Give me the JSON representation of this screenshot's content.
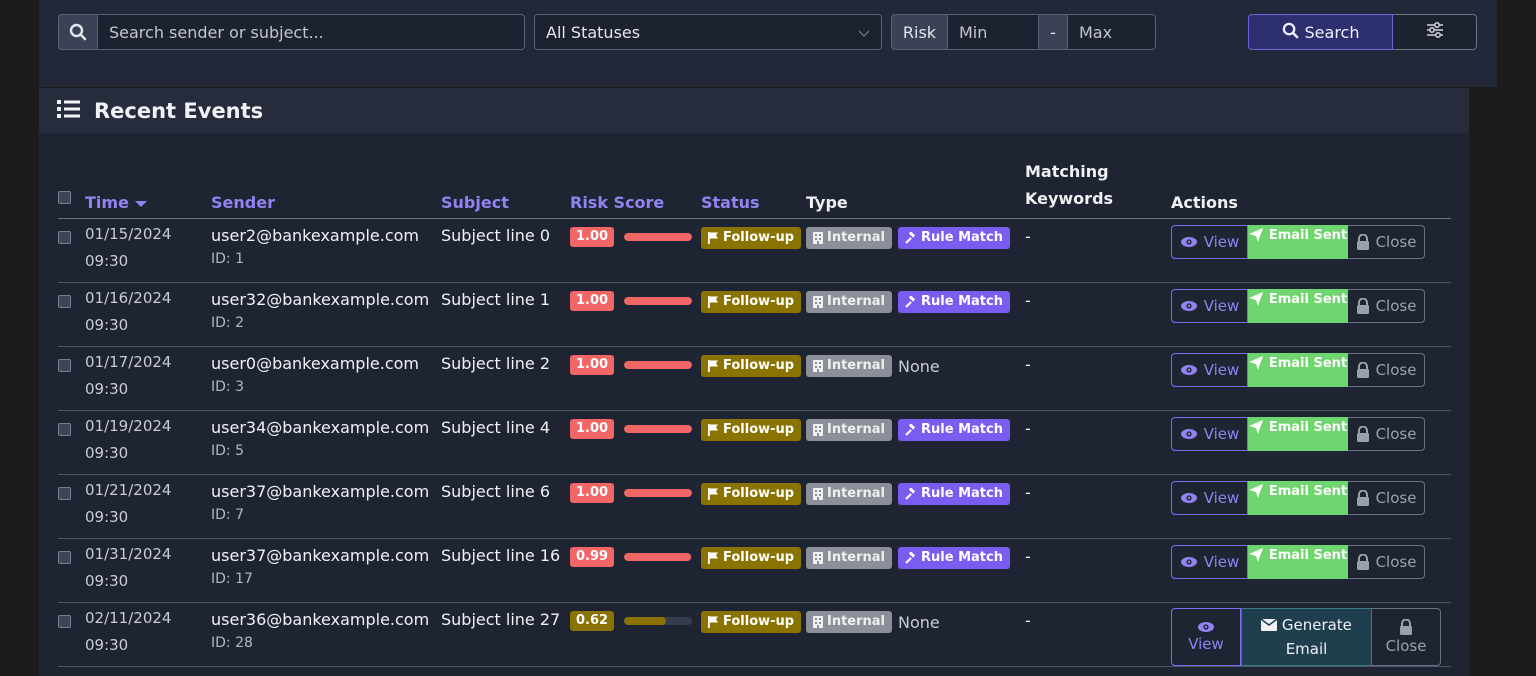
{
  "filters": {
    "search_placeholder": "Search sender or subject...",
    "status_value": "All Statuses",
    "risk_label": "Risk",
    "risk_min_placeholder": "Min",
    "risk_dash": "-",
    "risk_max_placeholder": "Max",
    "search_button": "Search"
  },
  "events": {
    "title": "Recent Events",
    "columns": {
      "time": "Time",
      "sender": "Sender",
      "subject": "Subject",
      "risk": "Risk Score",
      "status": "Status",
      "type": "Type",
      "keywords_line1": "Matching",
      "keywords_line2": "Keywords",
      "actions": "Actions"
    },
    "rows": [
      {
        "date": "01/15/2024",
        "time": "09:30",
        "sender": "user2@bankexample.com",
        "id": "ID: 1",
        "subject": "Subject line 0",
        "risk": "1.00",
        "risk_level": 1.0,
        "status": "Follow-up",
        "type": "Internal",
        "rule": "Rule Match",
        "keywords": "-",
        "view": "View",
        "email": "Email Sent",
        "close": "Close"
      },
      {
        "date": "01/16/2024",
        "time": "09:30",
        "sender": "user32@bankexample.com",
        "id": "ID: 2",
        "subject": "Subject line 1",
        "risk": "1.00",
        "risk_level": 1.0,
        "status": "Follow-up",
        "type": "Internal",
        "rule": "Rule Match",
        "keywords": "-",
        "view": "View",
        "email": "Email Sent",
        "close": "Close"
      },
      {
        "date": "01/17/2024",
        "time": "09:30",
        "sender": "user0@bankexample.com",
        "id": "ID: 3",
        "subject": "Subject line 2",
        "risk": "1.00",
        "risk_level": 1.0,
        "status": "Follow-up",
        "type": "Internal",
        "rule": "None",
        "keywords": "-",
        "view": "View",
        "email": "Email Sent",
        "close": "Close"
      },
      {
        "date": "01/19/2024",
        "time": "09:30",
        "sender": "user34@bankexample.com",
        "id": "ID: 5",
        "subject": "Subject line 4",
        "risk": "1.00",
        "risk_level": 1.0,
        "status": "Follow-up",
        "type": "Internal",
        "rule": "Rule Match",
        "keywords": "-",
        "view": "View",
        "email": "Email Sent",
        "close": "Close"
      },
      {
        "date": "01/21/2024",
        "time": "09:30",
        "sender": "user37@bankexample.com",
        "id": "ID: 7",
        "subject": "Subject line 6",
        "risk": "1.00",
        "risk_level": 1.0,
        "status": "Follow-up",
        "type": "Internal",
        "rule": "Rule Match",
        "keywords": "-",
        "view": "View",
        "email": "Email Sent",
        "close": "Close"
      },
      {
        "date": "01/31/2024",
        "time": "09:30",
        "sender": "user37@bankexample.com",
        "id": "ID: 17",
        "subject": "Subject line 16",
        "risk": "0.99",
        "risk_level": 0.99,
        "status": "Follow-up",
        "type": "Internal",
        "rule": "Rule Match",
        "keywords": "-",
        "view": "View",
        "email": "Email Sent",
        "close": "Close"
      },
      {
        "date": "02/11/2024",
        "time": "09:30",
        "sender": "user36@bankexample.com",
        "id": "ID: 28",
        "subject": "Subject line 27",
        "risk": "0.62",
        "risk_level": 0.62,
        "status": "Follow-up",
        "type": "Internal",
        "rule": "None",
        "keywords": "-",
        "view": "View",
        "email_line1": "Generate",
        "email_line2": "Email",
        "close": "Close"
      }
    ]
  },
  "colors": {
    "accent": "#8f84f0",
    "risk_high": "#f26666",
    "risk_medium": "#8a7300",
    "followup": "#8a7300",
    "internal": "#8a8f99",
    "rule_match": "#7b5cf0",
    "email_sent": "#6fd66f",
    "generate_email": "#1f3e4e"
  }
}
